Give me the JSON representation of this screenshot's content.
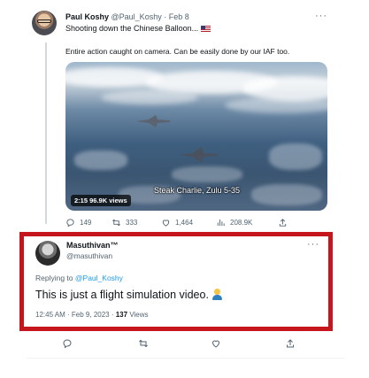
{
  "tweet1": {
    "name": "Paul Koshy",
    "handle": "@Paul_Koshy",
    "date": "Feb 8",
    "line1": "Shooting down the Chinese Balloon...",
    "line2": "Entire action caught on camera. Can be easily done by our IAF too.",
    "video_duration": "2:15",
    "video_views": "96.9K views",
    "video_overlay": "Steak Charlie, Zulu 5-35",
    "reply_count": "149",
    "retweet_count": "333",
    "like_count": "1,464",
    "view_count": "208.9K"
  },
  "tweet2": {
    "name": "Masuthivan™",
    "handle": "@masuthivan",
    "replying_prefix": "Replying to",
    "replying_handle": "@Paul_Koshy",
    "text": "This is just a flight simulation video.",
    "timestamp": "12:45 AM · Feb 9, 2023 ·",
    "views_count": "137",
    "views_label": "Views"
  },
  "colors": {
    "highlight_border": "#c5161d",
    "link": "#1d9bf0",
    "secondary_text": "#536471"
  },
  "icons": {
    "more": "more-options-icon",
    "reply": "reply-icon",
    "retweet": "retweet-icon",
    "like": "like-icon",
    "views": "views-icon",
    "share": "share-icon",
    "bookmark": "bookmark-icon",
    "flag": "us-flag-emoji",
    "emoji": "person-gesturing-emoji"
  }
}
